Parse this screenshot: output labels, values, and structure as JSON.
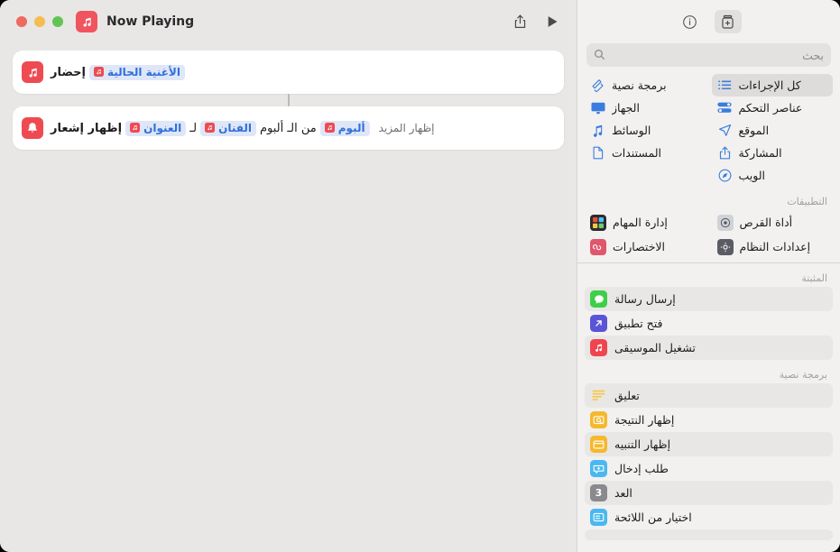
{
  "window": {
    "traffic_lights": [
      {
        "name": "close",
        "color": "#ee6a5f"
      },
      {
        "name": "minimize",
        "color": "#f5bd4f"
      },
      {
        "name": "zoom",
        "color": "#61c554"
      }
    ]
  },
  "sidebar": {
    "toolbar": [
      {
        "name": "info-button",
        "icon": "info-icon",
        "active": false
      },
      {
        "name": "add-action-button",
        "icon": "add-action-icon",
        "active": true
      }
    ],
    "search": {
      "placeholder": "بحث",
      "value": "",
      "icon": "search-icon"
    },
    "categories": [
      {
        "label": "كل الإجراءات",
        "icon": "list-icon",
        "selected": true
      },
      {
        "label": "برمجة نصية",
        "icon": "script-icon",
        "selected": false
      },
      {
        "label": "عناصر التحكم",
        "icon": "controls-icon",
        "selected": false
      },
      {
        "label": "الجهاز",
        "icon": "display-icon",
        "selected": false
      },
      {
        "label": "الموقع",
        "icon": "location-icon",
        "selected": false
      },
      {
        "label": "الوسائط",
        "icon": "music-note-icon",
        "selected": false
      },
      {
        "label": "المشاركة",
        "icon": "share-icon",
        "selected": false
      },
      {
        "label": "المستندات",
        "icon": "document-icon",
        "selected": false
      },
      {
        "label": "الويب",
        "icon": "safari-icon",
        "selected": false
      }
    ],
    "apps_section": {
      "title": "التطبيقات",
      "items": [
        {
          "label": "أداة القرص",
          "icon": "disk-utility-icon",
          "color": "#c9cdd3"
        },
        {
          "label": "إدارة المهام",
          "icon": "task-manager-icon",
          "color": "#2b2b31"
        },
        {
          "label": "إعدادات النظام",
          "icon": "system-settings-icon",
          "color": "#5b5b63"
        },
        {
          "label": "الاختصارات",
          "icon": "shortcuts-icon",
          "color": "#e0566b"
        }
      ]
    },
    "pinned_section": {
      "title": "المثبتة",
      "items": [
        {
          "label": "إرسال رسالة",
          "icon": "messages-icon",
          "color": "#3ecf4a",
          "alt": true
        },
        {
          "label": "فتح تطبيق",
          "icon": "open-app-icon",
          "color": "#5a55d6",
          "alt": false
        },
        {
          "label": "تشغيل الموسيقى",
          "icon": "music-icon",
          "color": "#f0444f",
          "alt": true
        }
      ]
    },
    "scripting_section": {
      "title": "برمجة نصية",
      "items": [
        {
          "label": "تعليق",
          "icon": "comment-icon",
          "color": "#f5c842",
          "alt": true
        },
        {
          "label": "إظهار النتيجة",
          "icon": "show-result-icon",
          "color": "#f5b82e",
          "alt": false
        },
        {
          "label": "إظهار التنبيه",
          "icon": "show-alert-icon",
          "color": "#f5b82e",
          "alt": true
        },
        {
          "label": "طلب إدخال",
          "icon": "ask-input-icon",
          "color": "#4ab8f0",
          "alt": false
        },
        {
          "label": "العد",
          "icon": "count-icon",
          "color": "#8a8a8e",
          "alt": true
        },
        {
          "label": "اختيار من اللائحة",
          "icon": "choose-from-list-icon",
          "color": "#4ab8f0",
          "alt": false
        }
      ]
    }
  },
  "main": {
    "toolbar": {
      "title": "Now Playing",
      "workflow_icon": "music-icon",
      "run_button_label": "تشغيل",
      "share_button_label": "مشاركة"
    },
    "actions": [
      {
        "icon": "music-icon",
        "parts": [
          {
            "type": "text",
            "value": "إحضار",
            "bold": true
          },
          {
            "type": "token",
            "value": "الأغنية الحالية",
            "icon": "music-icon"
          }
        ],
        "show_more": null
      },
      {
        "icon": "notification-icon",
        "parts": [
          {
            "type": "text",
            "value": "إظهار إشعار",
            "bold": true
          },
          {
            "type": "token",
            "value": "العنوان",
            "icon": "music-icon"
          },
          {
            "type": "text",
            "value": "لـ",
            "bold": false
          },
          {
            "type": "token",
            "value": "الفنان",
            "icon": "music-icon"
          },
          {
            "type": "text",
            "value": "من الـ ألبوم",
            "bold": false
          },
          {
            "type": "token",
            "value": "ألبوم",
            "icon": "music-icon"
          }
        ],
        "show_more": "إظهار المزيد"
      }
    ]
  }
}
